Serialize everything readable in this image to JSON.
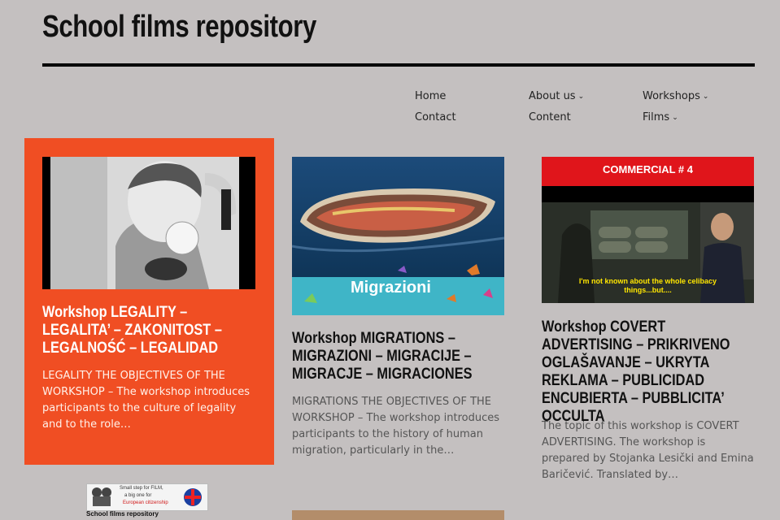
{
  "site": {
    "title": "School films repository"
  },
  "nav": {
    "home": "Home",
    "contact": "Contact",
    "about": "About us",
    "content": "Content",
    "workshops": "Workshops",
    "films": "Films",
    "chevron": "⌄"
  },
  "posts": [
    {
      "title": "Workshop LEGALITY – LEGALITA’ – ZAKONITOST – LEGALNOŚĆ – LEGALIDAD",
      "excerpt": "LEGALITY THE OBJECTIVES OF THE WORKSHOP – The workshop introduces participants to the culture of legality and to the role…",
      "thumb_icon": "boy-bubblegum-photo"
    },
    {
      "title": "Workshop MIGRATIONS – MIGRAZIONI – MIGRACIJE – MIGRACJE – MIGRACIONES",
      "excerpt": "MIGRATIONS THE OBJECTIVES OF THE WORKSHOP – The workshop introduces participants to the history of human migration, particularly in the…",
      "thumb_caption": "Migrazioni"
    },
    {
      "title": "Workshop COVERT ADVERTISING – PRIKRIVENO OGLAŠAVANJE – UKRYTA REKLAMA – PUBLICIDAD ENCUBIERTA – PUBBLICITA’ OCCULTA",
      "excerpt": "The topic of this workshop is COVERT ADVERTISING. The workshop is prepared by Stojanka Lesički and Emina Baričević. Translated by…",
      "thumb_banner": "COMMERCIAL # 4",
      "thumb_subtitle_1": "I'm not known about the whole celibacy",
      "thumb_subtitle_2": "things...but...."
    }
  ],
  "footer": {
    "logo_line1": "Small step for FILM,",
    "logo_line2": "a big one for",
    "logo_line3": "European citizenship",
    "caption": "School films repository"
  },
  "colors": {
    "accent": "#f04e23",
    "background": "#c4c0c0",
    "rule": "#000000"
  }
}
